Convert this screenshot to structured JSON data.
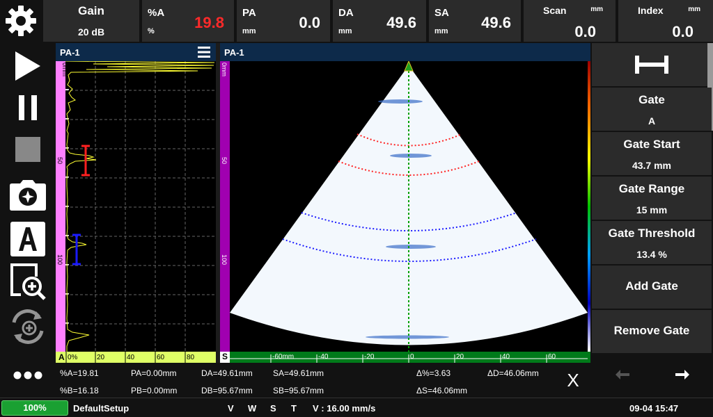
{
  "topbar": {
    "gain": {
      "label": "Gain",
      "value": "20 dB"
    },
    "pct_a": {
      "label": "%A",
      "unit": "%",
      "value": "19.8"
    },
    "pa": {
      "label": "PA",
      "unit": "mm",
      "value": "0.0"
    },
    "da": {
      "label": "DA",
      "unit": "mm",
      "value": "49.6"
    },
    "sa": {
      "label": "SA",
      "unit": "mm",
      "value": "49.6"
    },
    "scan": {
      "label": "Scan",
      "unit": "mm",
      "value": "0.0"
    },
    "index": {
      "label": "Index",
      "unit": "mm",
      "value": "0.0"
    }
  },
  "ascan": {
    "title": "PA-1",
    "depth_ticks": [
      "0mm",
      "50",
      "100"
    ],
    "amp_ticks": [
      "0%",
      "20",
      "40",
      "60",
      "80"
    ],
    "bottom_label": "A"
  },
  "sector": {
    "title": "PA-1",
    "depth_ticks": [
      "0mm",
      "50",
      "100"
    ],
    "x_ticks": [
      "-60mm",
      "-40",
      "-20",
      "0",
      "20",
      "40",
      "60"
    ],
    "bottom_label": "S"
  },
  "right_panel": {
    "gate": {
      "label": "Gate",
      "value": "A"
    },
    "gate_start": {
      "label": "Gate Start",
      "value": "43.7 mm"
    },
    "gate_range": {
      "label": "Gate Range",
      "value": "15 mm"
    },
    "gate_threshold": {
      "label": "Gate Threshold",
      "value": "13.4 %"
    },
    "add_gate": "Add Gate",
    "remove_gate": "Remove Gate"
  },
  "readout": {
    "pct_a": "%A=19.81",
    "pa": "PA=0.00mm",
    "da": "DA=49.61mm",
    "sa": "SA=49.61mm",
    "delta_pct": "Δ%=3.63",
    "delta_d": "ΔD=46.06mm",
    "pct_b": "%B=16.18",
    "pb": "PB=0.00mm",
    "db": "DB=95.67mm",
    "sb": "SB=95.67mm",
    "delta_s": "ΔS=46.06mm",
    "close": "X"
  },
  "statusbar": {
    "battery": "100%",
    "setup": "DefaultSetup",
    "v": "V",
    "w": "W",
    "s": "S",
    "t": "T",
    "velocity": "V : 16.00 mm/s",
    "datetime": "09-04 15:47"
  },
  "colors": {
    "gate_a": "#ff2020",
    "gate_b": "#1a1aff",
    "ascan_signal": "#ffff33",
    "cursor_line": "#00a000",
    "battery": "#1aa032"
  },
  "icons": [
    "settings-icon",
    "play-icon",
    "pause-icon",
    "stop-icon",
    "camera-icon",
    "text-label-icon",
    "zoom-icon",
    "rotate-zoom-icon",
    "more-icon",
    "gate-icon",
    "arrow-left-icon",
    "arrow-right-icon"
  ]
}
